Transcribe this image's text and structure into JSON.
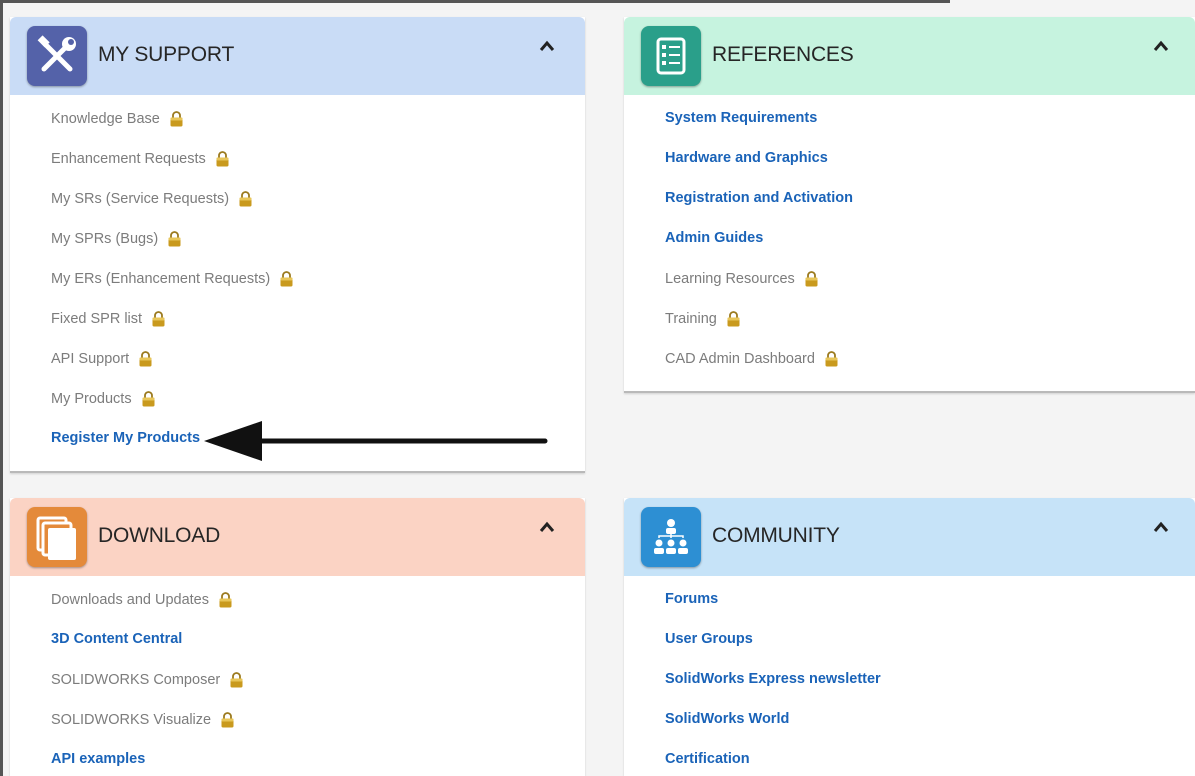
{
  "panels": {
    "my_support": {
      "title": "MY SUPPORT",
      "header_color": "#c9dcf6",
      "icon_color": "#5462a9",
      "icon": "tools-icon",
      "items": [
        {
          "label": "Knowledge Base",
          "locked": true
        },
        {
          "label": "Enhancement Requests",
          "locked": true
        },
        {
          "label": "My SRs (Service Requests)",
          "locked": true
        },
        {
          "label": "My SPRs (Bugs)",
          "locked": true
        },
        {
          "label": "My ERs (Enhancement Requests)",
          "locked": true
        },
        {
          "label": "Fixed SPR list",
          "locked": true
        },
        {
          "label": "API Support",
          "locked": true
        },
        {
          "label": "My Products",
          "locked": true
        },
        {
          "label": "Register My Products",
          "locked": false
        }
      ]
    },
    "references": {
      "title": "REFERENCES",
      "header_color": "#c6f3df",
      "icon_color": "#2a9f8a",
      "icon": "checklist-icon",
      "items": [
        {
          "label": "System Requirements",
          "locked": false
        },
        {
          "label": "Hardware and Graphics",
          "locked": false
        },
        {
          "label": "Registration and Activation",
          "locked": false
        },
        {
          "label": "Admin Guides",
          "locked": false
        },
        {
          "label": "Learning Resources",
          "locked": true
        },
        {
          "label": "Training",
          "locked": true
        },
        {
          "label": "CAD Admin Dashboard",
          "locked": true
        }
      ]
    },
    "download": {
      "title": "DOWNLOAD",
      "header_color": "#fbd3c4",
      "icon_color": "#e48a3a",
      "icon": "stacked-pages-icon",
      "items": [
        {
          "label": "Downloads and Updates",
          "locked": true
        },
        {
          "label": "3D Content Central",
          "locked": false
        },
        {
          "label": "SOLIDWORKS Composer",
          "locked": true
        },
        {
          "label": "SOLIDWORKS Visualize",
          "locked": true
        },
        {
          "label": "API examples",
          "locked": false
        }
      ]
    },
    "community": {
      "title": "COMMUNITY",
      "header_color": "#c6e3f8",
      "icon_color": "#2d8fd3",
      "icon": "people-network-icon",
      "items": [
        {
          "label": "Forums",
          "locked": false
        },
        {
          "label": "User Groups",
          "locked": false
        },
        {
          "label": "SolidWorks Express newsletter",
          "locked": false
        },
        {
          "label": "SolidWorks World",
          "locked": false
        },
        {
          "label": "Certification",
          "locked": false
        }
      ]
    }
  },
  "colors": {
    "link": "#1a63b8",
    "locked_text": "#7c7c7c",
    "lock_gold": "#c99a1e",
    "annotation_arrow": "#111111"
  }
}
